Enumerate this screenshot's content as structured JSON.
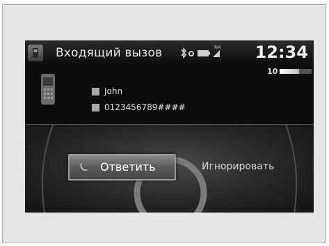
{
  "header": {
    "title": "Входящий вызов",
    "time": "12:34",
    "status_icons": [
      "bluetooth-icon",
      "phone-connected-icon",
      "battery-icon",
      "signal-icon"
    ],
    "roam_label": "RM"
  },
  "volume": {
    "level": "10",
    "fill_fraction": 0.6
  },
  "caller": {
    "name": "John",
    "number": "0123456789####"
  },
  "actions": {
    "answer_label": "Ответить",
    "ignore_label": "Игнорировать"
  },
  "colors": {
    "screen_bg": "#0d0d0d",
    "text": "#e8e8e8",
    "button": "#6e6e6e"
  }
}
